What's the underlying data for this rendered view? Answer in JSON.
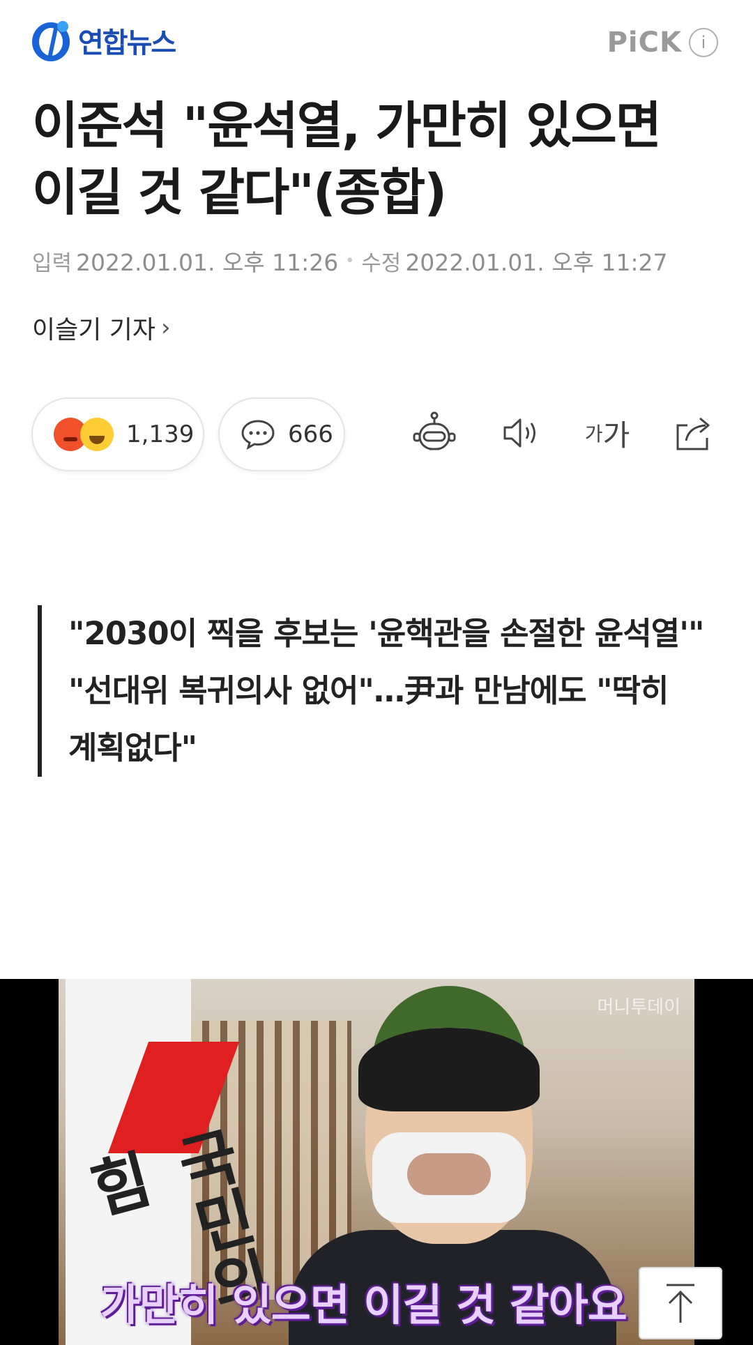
{
  "header": {
    "logo_text": "연합뉴스",
    "pick_label": "PiCK",
    "info_glyph": "i"
  },
  "article": {
    "title": "이준석 \"윤석열, 가만히 있으면 이길 것 같다\"(종합)",
    "published_label": "입력",
    "published": "2022.01.01. 오후 11:26",
    "modified_label": "수정",
    "modified": "2022.01.01. 오후 11:27",
    "reporter": "이슬기 기자",
    "reporter_chevron": "›"
  },
  "actions": {
    "reactions_count": "1,139",
    "comments_count": "666",
    "font_small": "가",
    "font_large": "가",
    "icons": [
      "angry-emoji",
      "happy-emoji",
      "comment-icon",
      "bot-icon",
      "speaker-icon",
      "font-size-icon",
      "share-icon"
    ]
  },
  "summary": {
    "lines": [
      "\"2030이 찍을 후보는 '윤핵관을 손절한 윤석열'\"",
      "\"선대위 복귀의사 없어\"…尹과 만남에도 \"딱히 계획없다\""
    ]
  },
  "photo": {
    "flag_text": "국민의힘",
    "caption": "가만히 있으면 이길 것 같아요",
    "watermark": "머니투데이"
  },
  "colors": {
    "brand": "#1a4db3",
    "caption": "#e8d0ff",
    "angry": "#f0512a",
    "happy": "#ffcc33"
  }
}
